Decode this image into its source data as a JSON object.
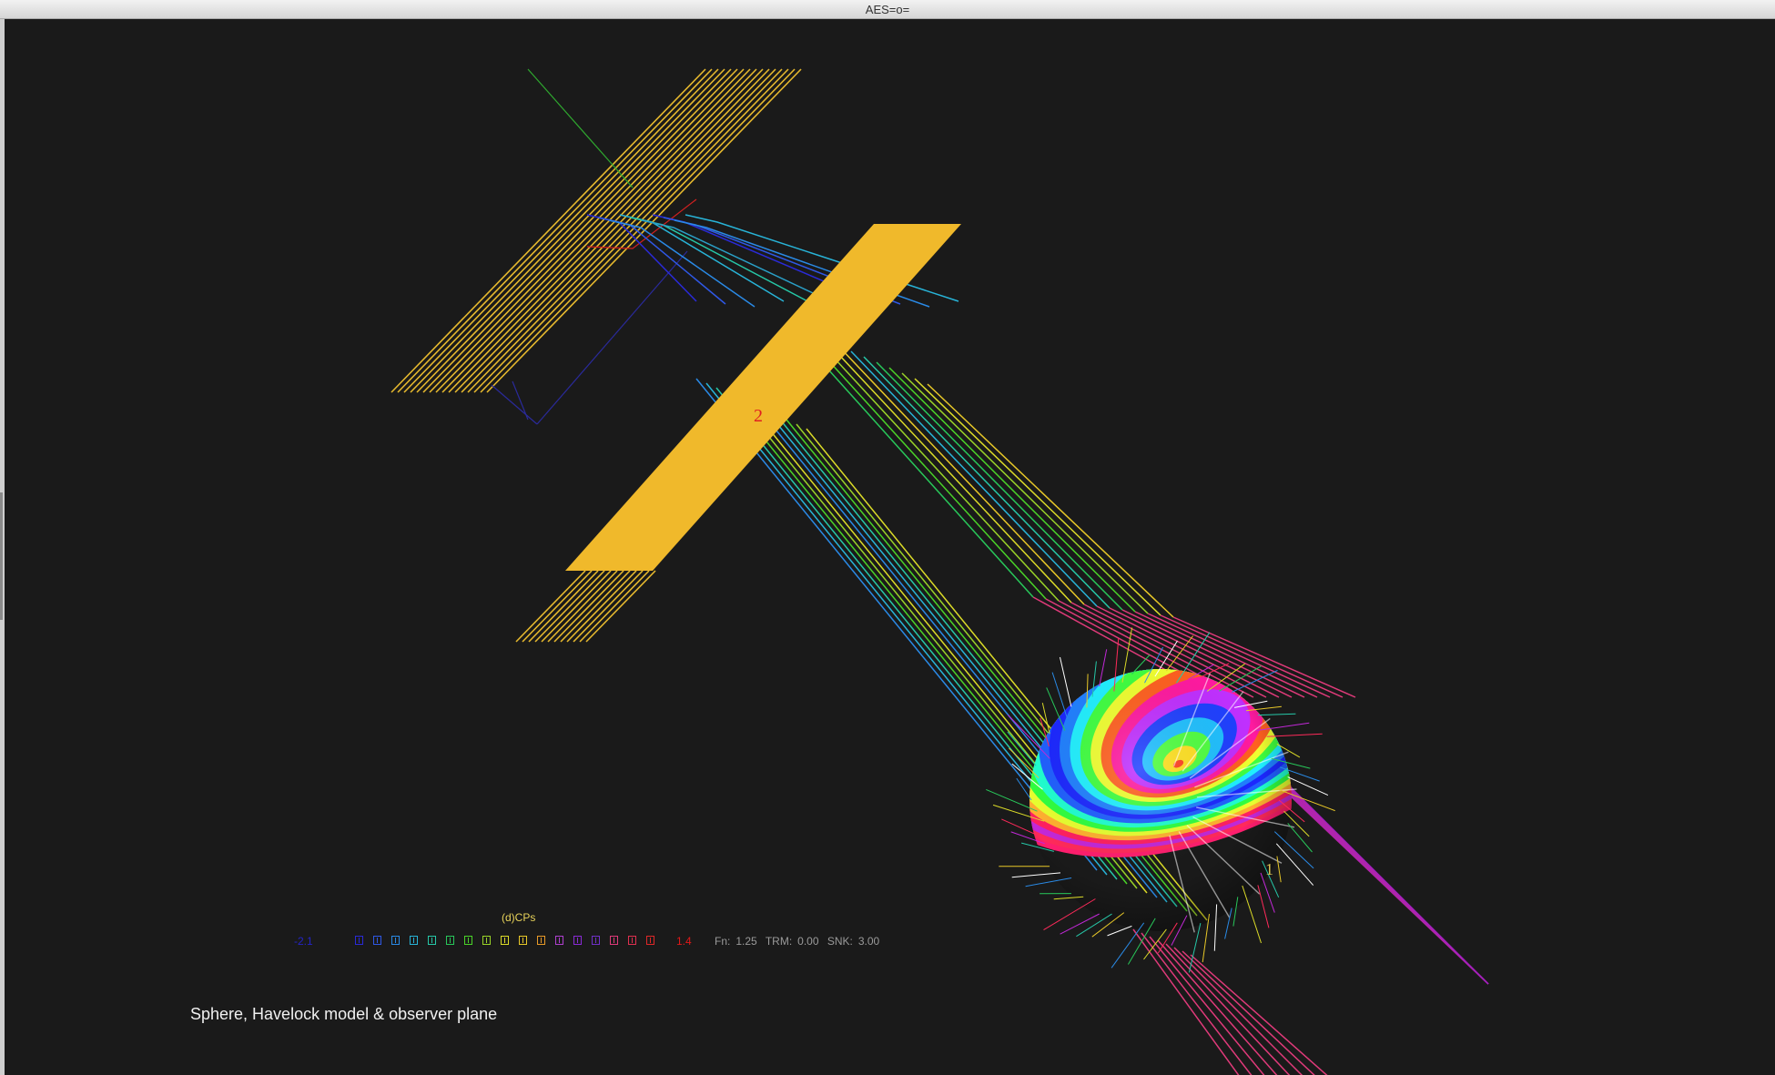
{
  "window": {
    "title": "AES=o="
  },
  "scene": {
    "caption": "Sphere, Havelock model & observer plane",
    "label_plane": "2",
    "label_sphere": "1"
  },
  "legend": {
    "title": "(d)CPs",
    "min_label": "-2.1",
    "max_label": "1.4",
    "swatch_colors": [
      "#2a2ad8",
      "#2f58e6",
      "#2a8ae6",
      "#28b4d8",
      "#26c8a8",
      "#28c85a",
      "#4ad428",
      "#9ad428",
      "#dcdc28",
      "#e8c828",
      "#e89a28",
      "#b040d0",
      "#8a2ad8",
      "#7030c8",
      "#e03a7a",
      "#e03050",
      "#e02828"
    ]
  },
  "status": {
    "fn_label": "Fn:",
    "fn_value": "1.25",
    "trm_label": "TRM:",
    "trm_value": "0.00",
    "snk_label": "SNK:",
    "snk_value": "3.00"
  }
}
